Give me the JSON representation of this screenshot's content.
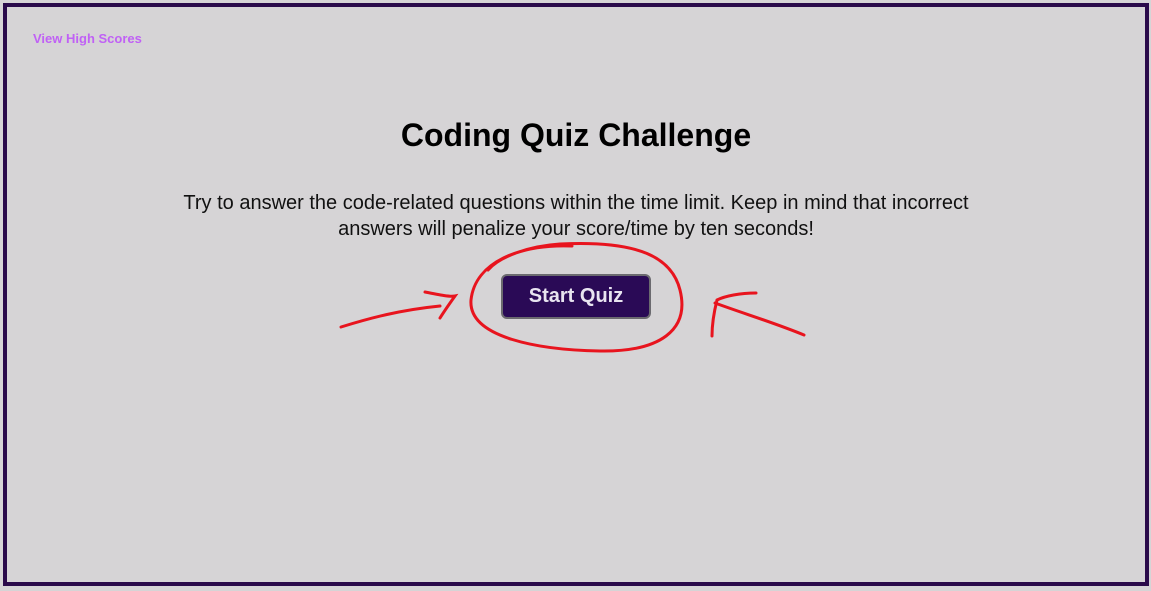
{
  "header": {
    "high_scores_link": "View High Scores"
  },
  "intro": {
    "title": "Coding Quiz Challenge",
    "description": "Try to answer the code-related questions within the time limit. Keep in mind that incorrect answers will penalize your score/time by ten seconds!",
    "start_button": "Start Quiz"
  },
  "colors": {
    "border": "#2a0a4a",
    "background": "#d6d4d6",
    "link": "#c061f5",
    "button": "#2a0a56",
    "annotation": "#e8141e"
  }
}
